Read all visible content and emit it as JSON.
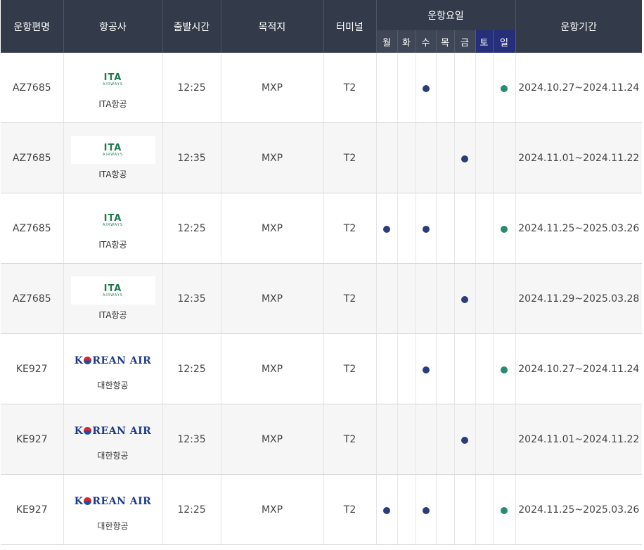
{
  "header": {
    "flight": "운항편명",
    "airline": "항공사",
    "departure": "출발시간",
    "destination": "목적지",
    "terminal": "터미널",
    "days_group": "운항요일",
    "period": "운항기간",
    "days": [
      "월",
      "화",
      "수",
      "목",
      "금",
      "토",
      "일"
    ]
  },
  "colors": {
    "header_bg": "#333b4b",
    "weekend_header_bg": "#26307a",
    "weekday_dot": "#2b3c7a",
    "sunday_dot": "#2a8a72"
  },
  "rows": [
    {
      "flight": "AZ7685",
      "logo": "ITA AIRWAYS",
      "airline": "ITA항공",
      "time": "12:25",
      "dest": "MXP",
      "terminal": "T2",
      "days": [
        false,
        false,
        true,
        false,
        false,
        false,
        true
      ],
      "period": "2024.10.27~2024.11.24"
    },
    {
      "flight": "AZ7685",
      "logo": "ITA AIRWAYS",
      "airline": "ITA항공",
      "time": "12:35",
      "dest": "MXP",
      "terminal": "T2",
      "days": [
        false,
        false,
        false,
        false,
        true,
        false,
        false
      ],
      "period": "2024.11.01~2024.11.22"
    },
    {
      "flight": "AZ7685",
      "logo": "ITA AIRWAYS",
      "airline": "ITA항공",
      "time": "12:25",
      "dest": "MXP",
      "terminal": "T2",
      "days": [
        true,
        false,
        true,
        false,
        false,
        false,
        true
      ],
      "period": "2024.11.25~2025.03.26"
    },
    {
      "flight": "AZ7685",
      "logo": "ITA AIRWAYS",
      "airline": "ITA항공",
      "time": "12:35",
      "dest": "MXP",
      "terminal": "T2",
      "days": [
        false,
        false,
        false,
        false,
        true,
        false,
        false
      ],
      "period": "2024.11.29~2025.03.28"
    },
    {
      "flight": "KE927",
      "logo": "KOREAN AIR",
      "airline": "대한항공",
      "time": "12:25",
      "dest": "MXP",
      "terminal": "T2",
      "days": [
        false,
        false,
        true,
        false,
        false,
        false,
        true
      ],
      "period": "2024.10.27~2024.11.24"
    },
    {
      "flight": "KE927",
      "logo": "KOREAN AIR",
      "airline": "대한항공",
      "time": "12:35",
      "dest": "MXP",
      "terminal": "T2",
      "days": [
        false,
        false,
        false,
        false,
        true,
        false,
        false
      ],
      "period": "2024.11.01~2024.11.22"
    },
    {
      "flight": "KE927",
      "logo": "KOREAN AIR",
      "airline": "대한항공",
      "time": "12:25",
      "dest": "MXP",
      "terminal": "T2",
      "days": [
        true,
        false,
        true,
        false,
        false,
        false,
        true
      ],
      "period": "2024.11.25~2025.03.26"
    }
  ]
}
